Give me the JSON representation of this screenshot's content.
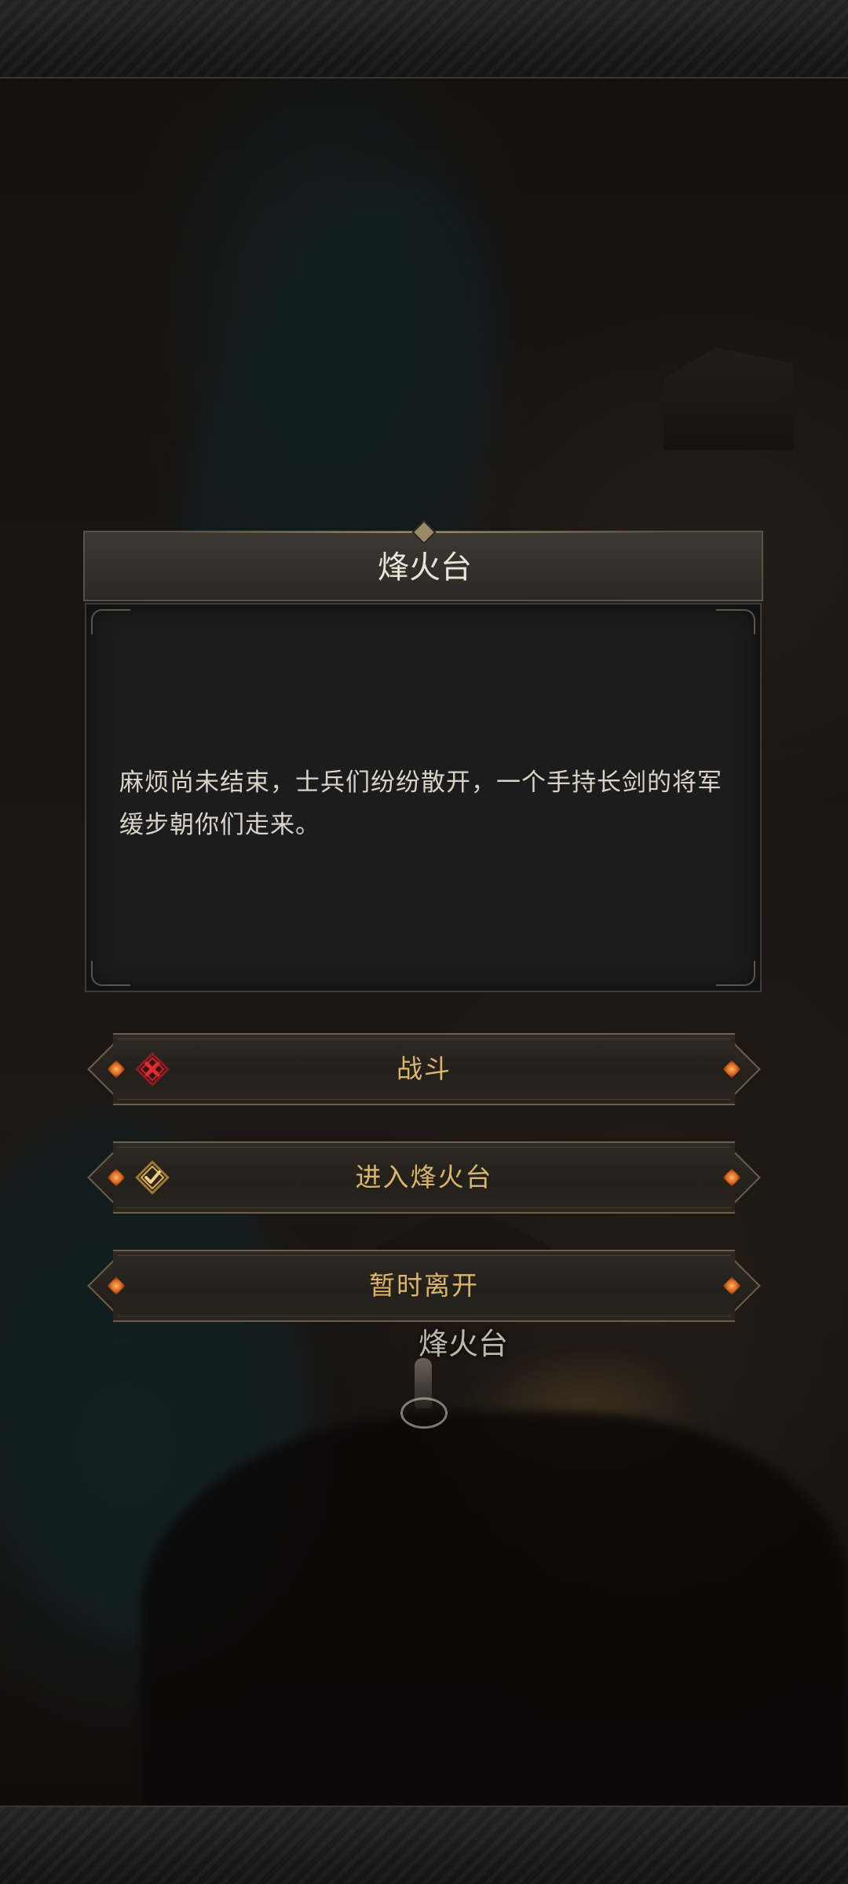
{
  "dialog": {
    "title": "烽火台",
    "text": "麻烦尚未结束，士兵们纷纷散开，一个手持长剑的将军缓步朝你们走来。"
  },
  "options": [
    {
      "label": "战斗",
      "icon": "red-x-icon"
    },
    {
      "label": "进入烽火台",
      "icon": "gold-check-icon"
    },
    {
      "label": "暂时离开",
      "icon": "none"
    }
  ],
  "map": {
    "location_label": "烽火台"
  },
  "colors": {
    "option_text": "#d9b56f",
    "dialog_text": "#d9d3c8",
    "title_text": "#ebe3d4",
    "fight_icon": "#c8232a",
    "check_icon": "#d8b25a"
  }
}
